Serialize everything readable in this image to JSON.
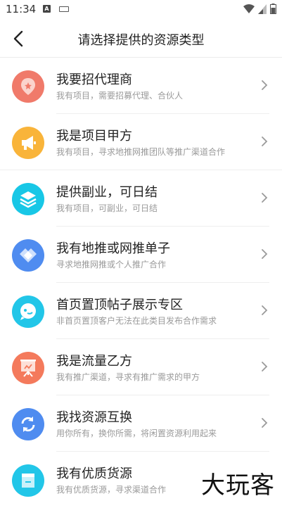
{
  "status_bar": {
    "time": "11:34",
    "a_badge": "A"
  },
  "header": {
    "title": "请选择提供的资源类型"
  },
  "items": [
    {
      "title": "我要招代理商",
      "desc": "我有项目，需要招募代理、合伙人",
      "icon": "agent-icon",
      "color": "#f07a6a"
    },
    {
      "title": "我是项目甲方",
      "desc": "我有项目，寻求地推网推团队等推广渠道合作",
      "icon": "megaphone-icon",
      "color": "#f9b43a"
    },
    {
      "title": "提供副业，可日结",
      "desc": "我有项目，可副业，可日结",
      "icon": "layers-icon",
      "color": "#18c7e6"
    },
    {
      "title": "我有地推或网推单子",
      "desc": "寻求地推网推或个人推广合作",
      "icon": "handshake-icon",
      "color": "#4f8cf0"
    },
    {
      "title": "首页置顶帖子展示专区",
      "desc": "非首页置顶客户无法在此类目发布合作需求",
      "icon": "chat-bubble-icon",
      "color": "#22c6e8"
    },
    {
      "title": "我是流量乙方",
      "desc": "我有推广渠道，寻求有推广需求的甲方",
      "icon": "presentation-icon",
      "color": "#f47a5c"
    },
    {
      "title": "我找资源互换",
      "desc": "用你所有，换你所需，将闲置资源利用起来",
      "icon": "exchange-icon",
      "color": "#4f8cf0"
    },
    {
      "title": "我有优质货源",
      "desc": "我有优质货源，寻求渠道合作",
      "icon": "box-icon",
      "color": "#22c6e8"
    }
  ],
  "watermark": "大玩客"
}
